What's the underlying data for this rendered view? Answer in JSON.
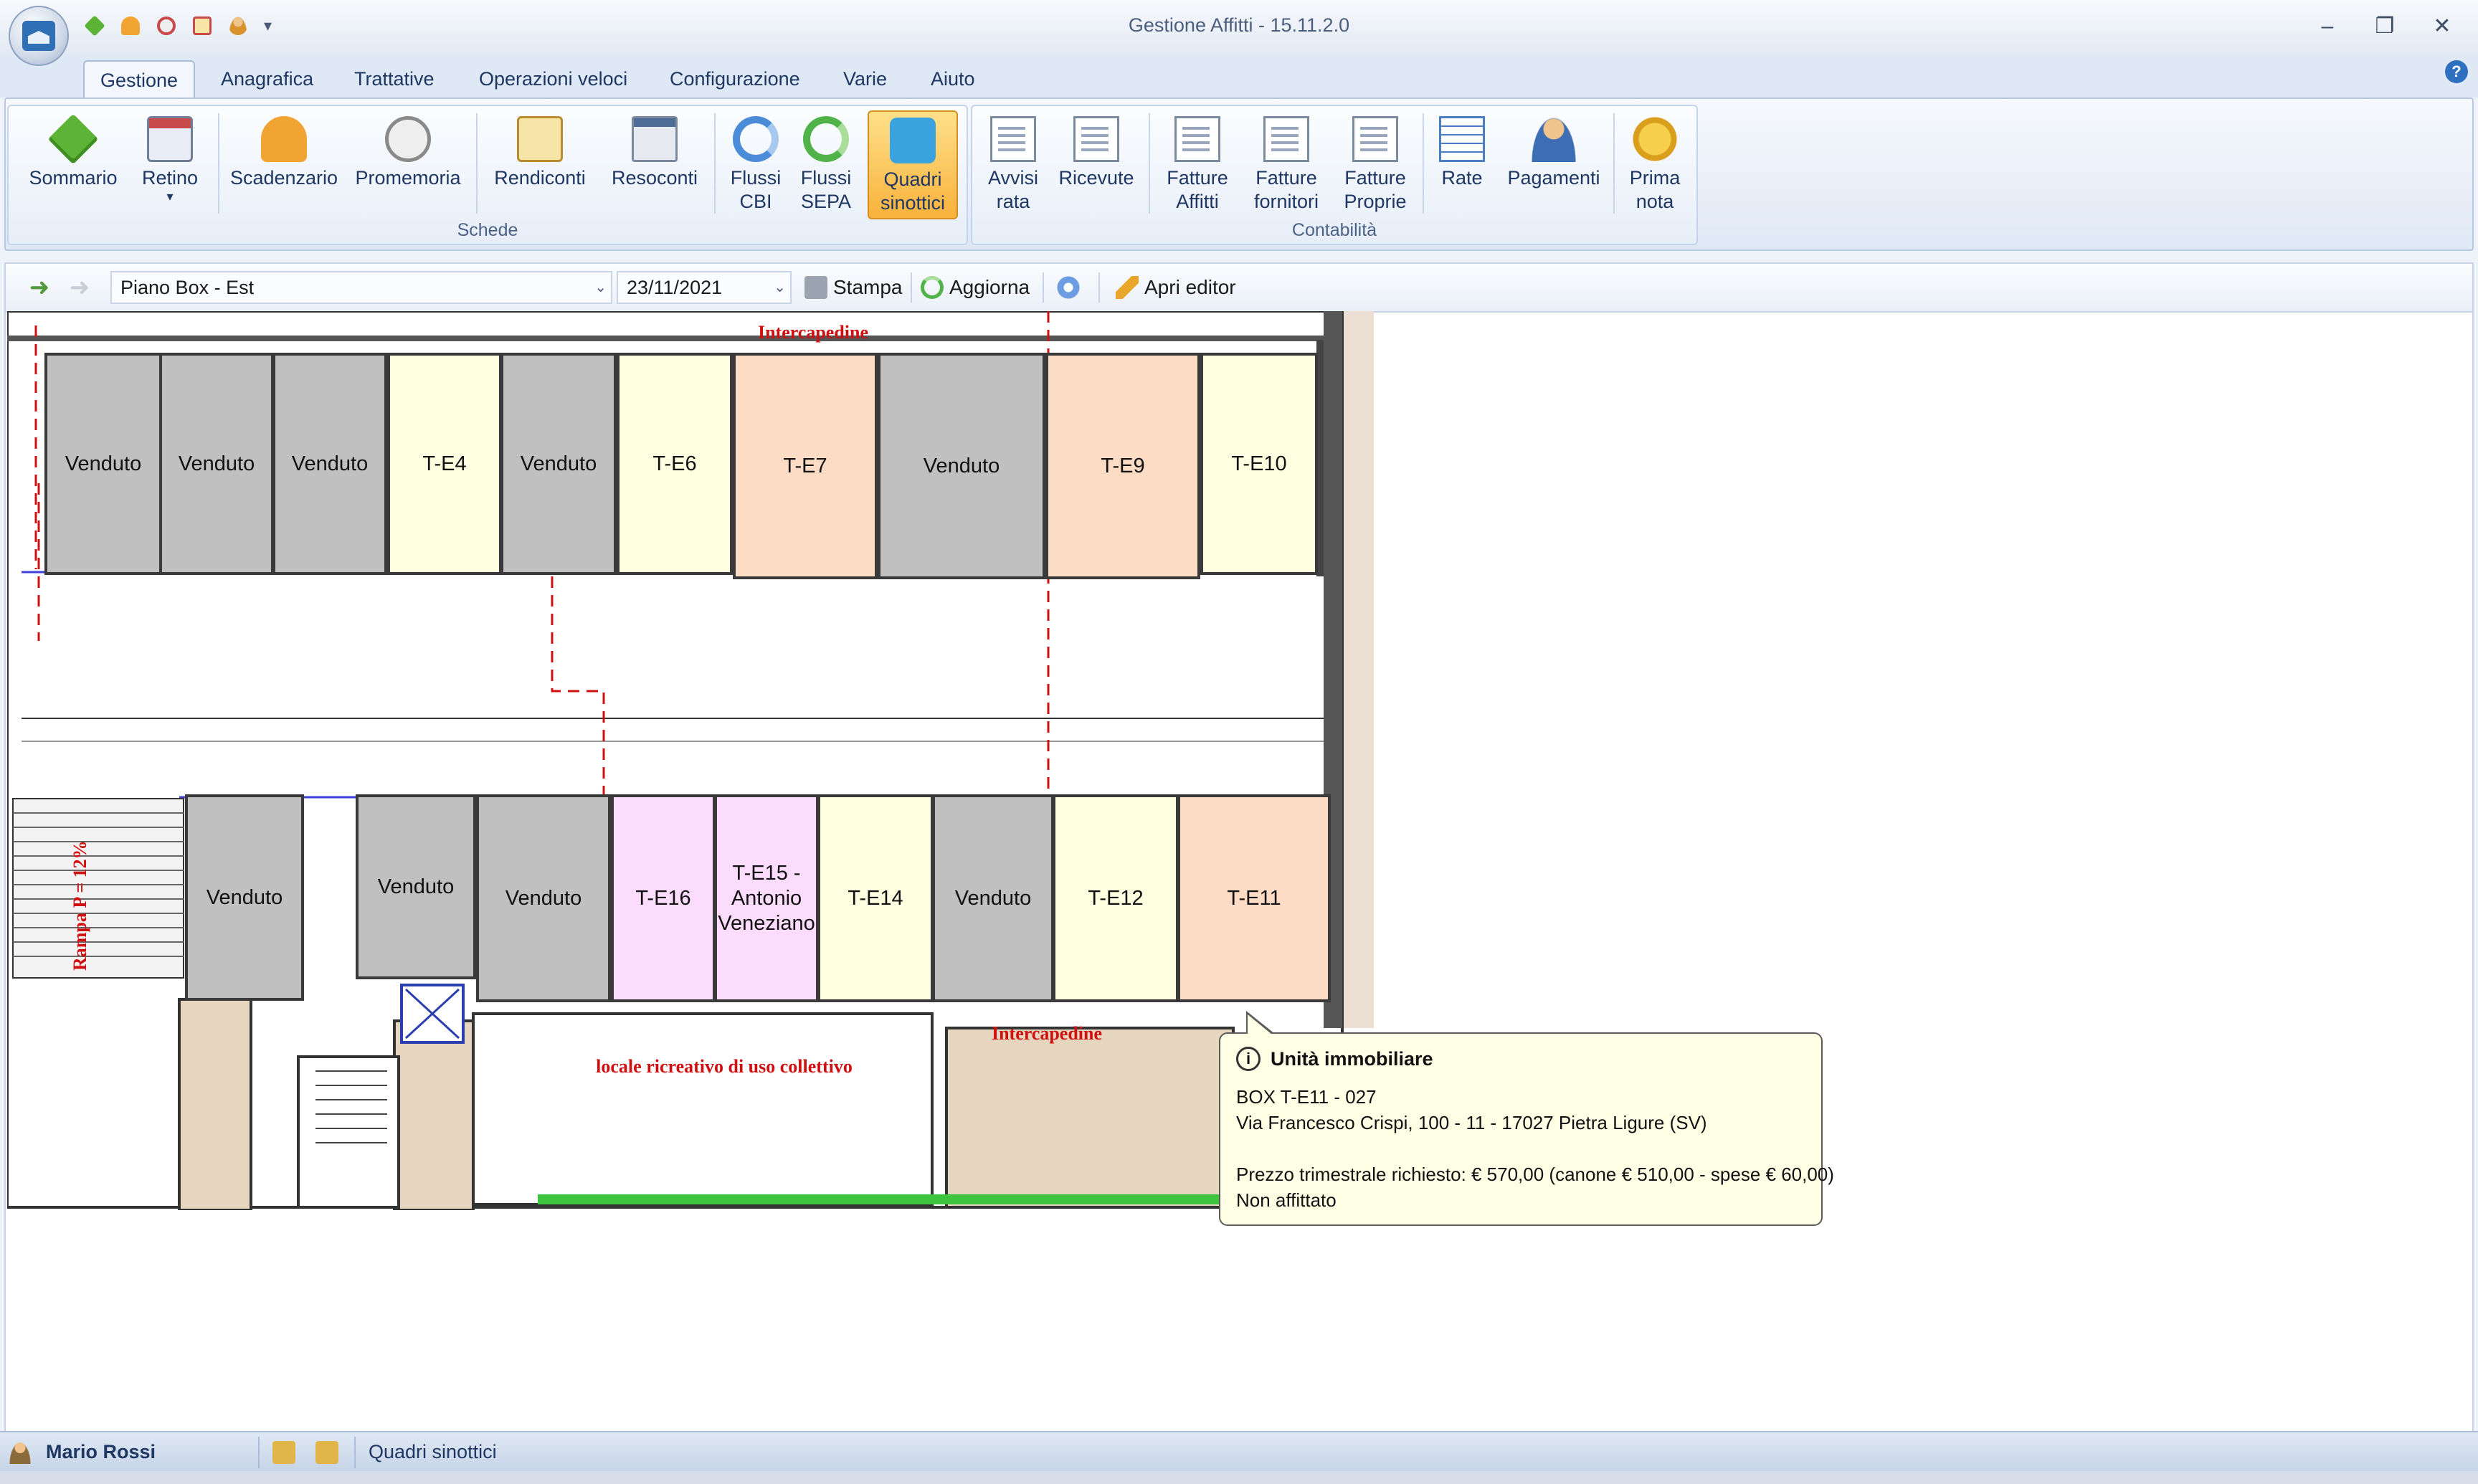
{
  "window": {
    "title": "Gestione Affitti - 15.11.2.0"
  },
  "tabs": [
    "Gestione",
    "Anagrafica",
    "Trattative",
    "Operazioni veloci",
    "Configurazione",
    "Varie",
    "Aiuto"
  ],
  "ribbon": {
    "schede": {
      "label": "Schede",
      "buttons": [
        {
          "line1": "Sommario",
          "line2": ""
        },
        {
          "line1": "Retino",
          "line2": "▾"
        },
        {
          "line1": "Scadenzario",
          "line2": ""
        },
        {
          "line1": "Promemoria",
          "line2": ""
        },
        {
          "line1": "Rendiconti",
          "line2": ""
        },
        {
          "line1": "Resoconti",
          "line2": ""
        },
        {
          "line1": "Flussi",
          "line2": "CBI"
        },
        {
          "line1": "Flussi",
          "line2": "SEPA"
        },
        {
          "line1": "Quadri",
          "line2": "sinottici"
        }
      ]
    },
    "contabilita": {
      "label": "Contabilità",
      "buttons": [
        {
          "line1": "Avvisi",
          "line2": "rata"
        },
        {
          "line1": "Ricevute",
          "line2": ""
        },
        {
          "line1": "Fatture",
          "line2": "Affitti"
        },
        {
          "line1": "Fatture",
          "line2": "fornitori"
        },
        {
          "line1": "Fatture",
          "line2": "Proprie"
        },
        {
          "line1": "Rate",
          "line2": ""
        },
        {
          "line1": "Pagamenti",
          "line2": ""
        },
        {
          "line1": "Prima",
          "line2": "nota"
        }
      ]
    }
  },
  "toolbar": {
    "plan_select": "Piano Box - Est",
    "date": "23/11/2021",
    "print_label": "Stampa",
    "refresh_label": "Aggiorna",
    "editor_label": "Apri editor"
  },
  "plan": {
    "labels": {
      "intercapedine_top": "Intercapedine",
      "intercapedine_bottom": "Intercapedine",
      "locale": "locale ricreativo di uso collettivo",
      "rampa": "Rampa P = 12%"
    },
    "top_row": [
      "Venduto",
      "Venduto",
      "Venduto",
      "T-E4",
      "Venduto",
      "T-E6",
      "T-E7",
      "Venduto",
      "T-E9",
      "T-E10"
    ],
    "bottom_row": [
      "Venduto",
      "Venduto",
      "Venduto",
      "T-E16",
      "T-E15 -\nAntonio\nVeneziano",
      "T-E14",
      "Venduto",
      "T-E12",
      "T-E11"
    ],
    "colors": {
      "venduto": "#c0c0c0",
      "free": "#fefee0",
      "orange": "#fcdcc4",
      "pink": "#fcdcfc"
    }
  },
  "tooltip": {
    "title": "Unità immobiliare",
    "line1": "BOX T-E11 - 027",
    "line2": "Via Francesco Crispi, 100 - 11 - 17027 Pietra Ligure (SV)",
    "line3": "Prezzo trimestrale richiesto: € 570,00 (canone € 510,00 - spese € 60,00)",
    "line4": "Non affittato"
  },
  "status": {
    "user": "Mario Rossi",
    "module": "Quadri sinottici"
  },
  "icons": {
    "app": "app-orb-icon",
    "help": "help-icon"
  }
}
